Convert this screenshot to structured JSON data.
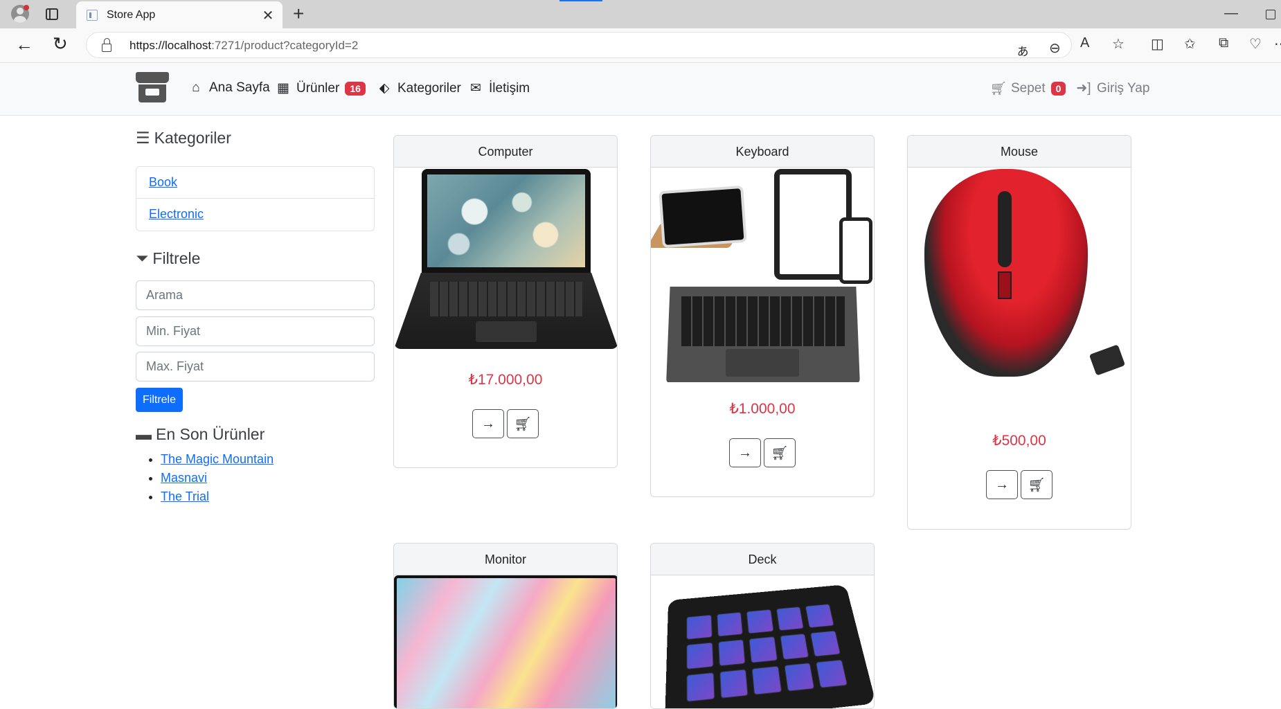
{
  "browser": {
    "tab_title": "Store App",
    "url_host": "https://localhost",
    "url_rest": ":7271/product?categoryId=2"
  },
  "navbar": {
    "home": "Ana Sayfa",
    "products": "Ürünler",
    "products_badge": "16",
    "categories": "Kategoriler",
    "contact": "İletişim",
    "cart": "Sepet",
    "cart_badge": "0",
    "login": "Giriş Yap"
  },
  "sidebar": {
    "categories_heading": "Kategoriler",
    "categories": [
      {
        "label": "Book"
      },
      {
        "label": "Electronic"
      }
    ],
    "filter_heading": "Filtrele",
    "search_placeholder": "Arama",
    "min_price_placeholder": "Min. Fiyat",
    "max_price_placeholder": "Max. Fiyat",
    "filter_button": "Filtrele",
    "recent_heading": "En Son Ürünler",
    "recent": [
      {
        "label": "The Magic Mountain"
      },
      {
        "label": "Masnavi"
      },
      {
        "label": "The Trial"
      }
    ]
  },
  "products": [
    {
      "name": "Computer",
      "price": "₺17.000,00",
      "image": "laptop"
    },
    {
      "name": "Keyboard",
      "price": "₺1.000,00",
      "image": "tablet-keyboard"
    },
    {
      "name": "Mouse",
      "price": "₺500,00",
      "image": "wireless-mouse"
    },
    {
      "name": "Monitor",
      "price": "",
      "image": "monitor"
    },
    {
      "name": "Deck",
      "price": "",
      "image": "stream-deck"
    }
  ],
  "icons": {
    "details": "arrow-right-icon",
    "add_to_cart": "cart-plus-icon"
  },
  "colors": {
    "primary": "#0d6efd",
    "danger": "#dc3545",
    "navbar_bg": "#f8f9fa"
  }
}
